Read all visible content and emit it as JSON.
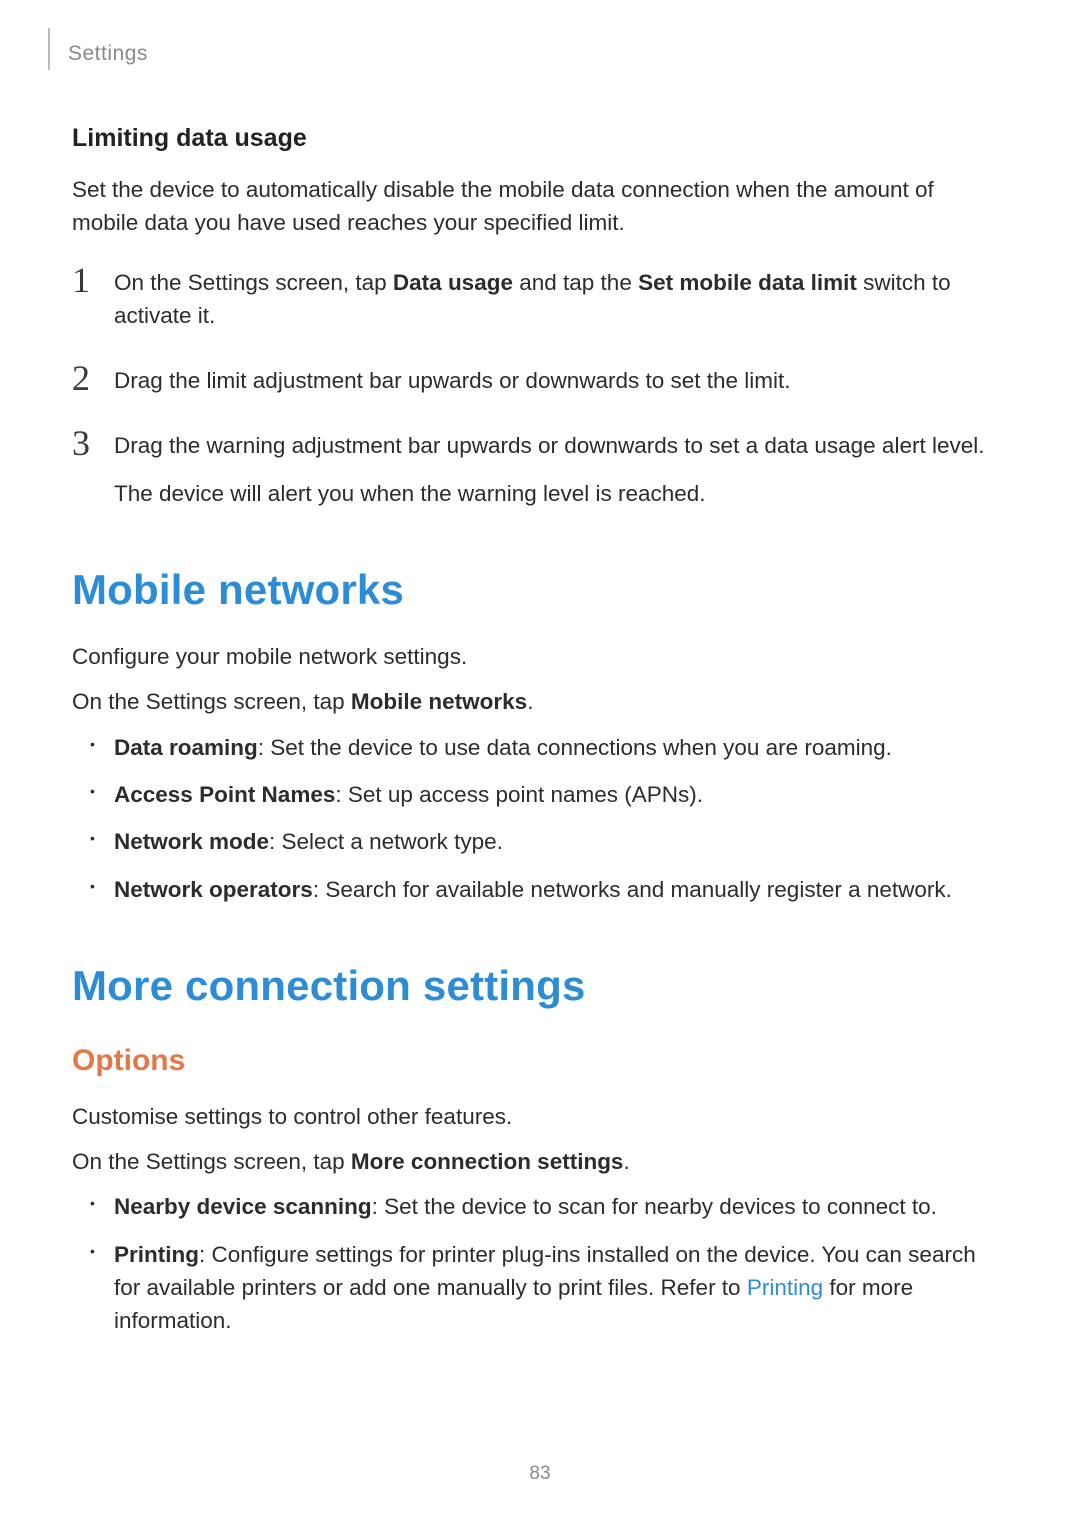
{
  "header": {
    "section": "Settings"
  },
  "limiting": {
    "heading": "Limiting data usage",
    "intro": "Set the device to automatically disable the mobile data connection when the amount of mobile data you have used reaches your specified limit.",
    "step1_a": "On the Settings screen, tap ",
    "step1_b": "Data usage",
    "step1_c": " and tap the ",
    "step1_d": "Set mobile data limit",
    "step1_e": " switch to activate it.",
    "step2": "Drag the limit adjustment bar upwards or downwards to set the limit.",
    "step3_a": "Drag the warning adjustment bar upwards or downwards to set a data usage alert level.",
    "step3_b": "The device will alert you when the warning level is reached.",
    "nums": {
      "n1": "1",
      "n2": "2",
      "n3": "3"
    }
  },
  "mobile": {
    "heading": "Mobile networks",
    "intro": "Configure your mobile network settings.",
    "nav_a": "On the Settings screen, tap ",
    "nav_b": "Mobile networks",
    "nav_c": ".",
    "items": [
      {
        "label": "Data roaming",
        "desc": ": Set the device to use data connections when you are roaming."
      },
      {
        "label": "Access Point Names",
        "desc": ": Set up access point names (APNs)."
      },
      {
        "label": "Network mode",
        "desc": ": Select a network type."
      },
      {
        "label": "Network operators",
        "desc": ": Search for available networks and manually register a network."
      }
    ]
  },
  "more": {
    "heading": "More connection settings",
    "options_heading": "Options",
    "intro": "Customise settings to control other features.",
    "nav_a": "On the Settings screen, tap ",
    "nav_b": "More connection settings",
    "nav_c": ".",
    "items": [
      {
        "label": "Nearby device scanning",
        "desc": ": Set the device to scan for nearby devices to connect to."
      },
      {
        "label": "Printing",
        "desc_a": ": Configure settings for printer plug-ins installed on the device. You can search for available printers or add one manually to print files. Refer to ",
        "link": "Printing",
        "desc_b": " for more information."
      }
    ]
  },
  "page_number": "83"
}
